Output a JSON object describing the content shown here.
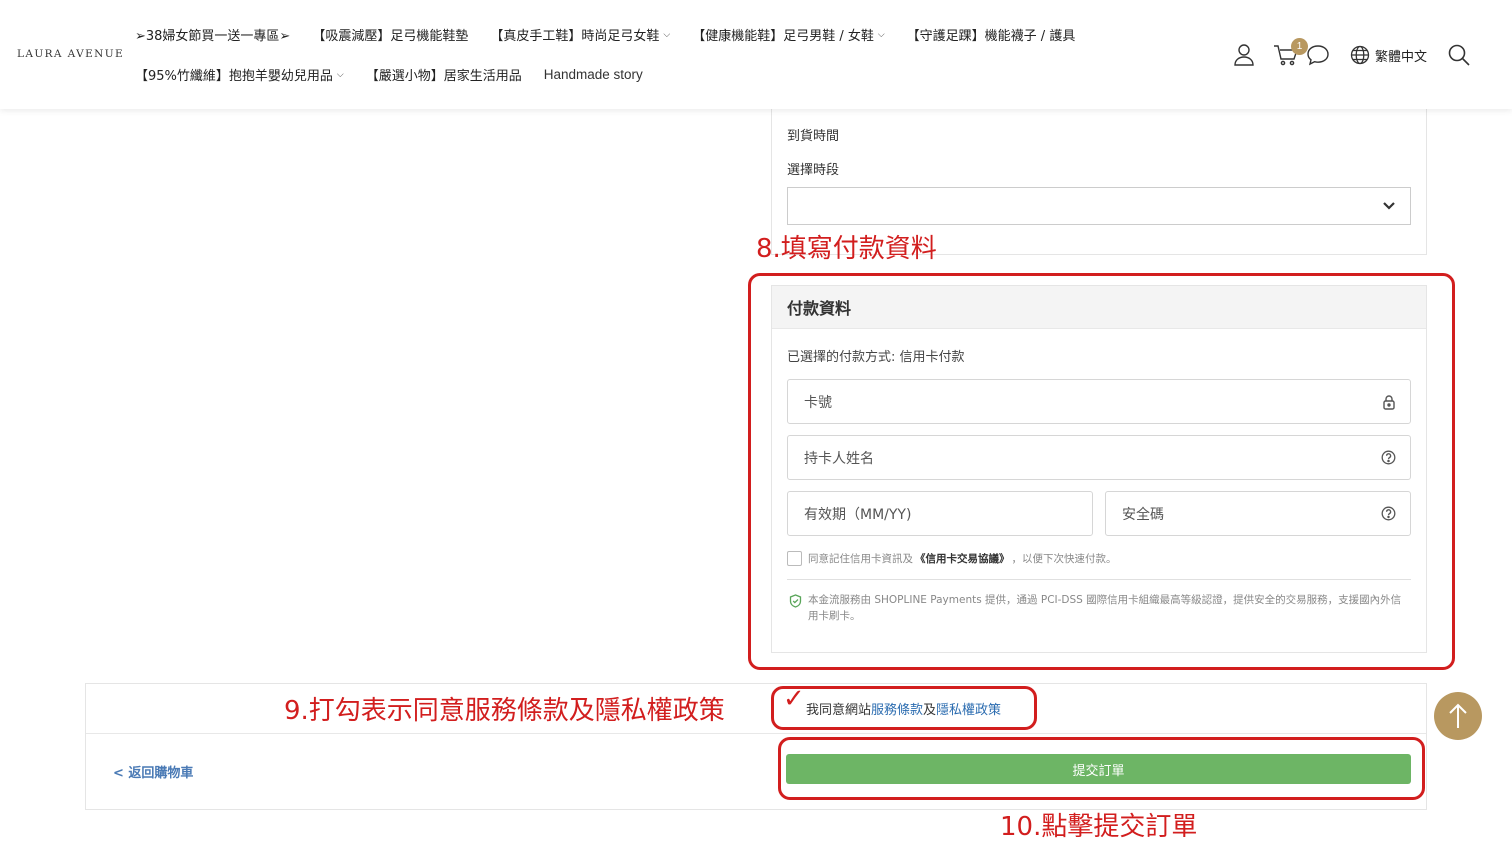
{
  "header": {
    "brand": "LAURA AVENUE",
    "nav_row1": [
      {
        "label": "➢38婦女節買一送一專區➢",
        "has_chevron": false
      },
      {
        "label": "【吸震減壓】足弓機能鞋墊",
        "has_chevron": false
      },
      {
        "label": "【真皮手工鞋】時尚足弓女鞋",
        "has_chevron": true
      },
      {
        "label": "【健康機能鞋】足弓男鞋 / 女鞋",
        "has_chevron": true
      },
      {
        "label": "【守護足踝】機能襪子 / 護具",
        "has_chevron": false
      }
    ],
    "nav_row2": [
      {
        "label": "【95%竹纖維】抱抱羊嬰幼兒用品",
        "has_chevron": true
      },
      {
        "label": "【嚴選小物】居家生活用品",
        "has_chevron": false
      },
      {
        "label": "Handmade story",
        "has_chevron": false
      }
    ],
    "cart_count": "1",
    "language": "繁體中文",
    "icons": [
      "user-icon",
      "cart-icon",
      "chat-icon",
      "globe-icon",
      "search-icon"
    ]
  },
  "delivery": {
    "arrival_label": "到貨時間",
    "slot_label": "選擇時段",
    "slot_value": ""
  },
  "annotations": {
    "step8": "8.填寫付款資料",
    "step9": "9.打勾表示同意服務條款及隱私權政策",
    "step10": "10.點擊提交訂單",
    "check": "✓"
  },
  "payment": {
    "title": "付款資料",
    "method_text": "已選擇的付款方式: 信用卡付款",
    "card_number_placeholder": "卡號",
    "holder_placeholder": "持卡人姓名",
    "expiry_placeholder": "有效期（MM/YY)",
    "cvc_placeholder": "安全碼",
    "remember_prefix": "同意記住信用卡資訊及",
    "remember_link": "《信用卡交易協議》",
    "remember_suffix": "，以便下次快速付款。",
    "secure_text": "本金流服務由 SHOPLINE Payments 提供，通過 PCI-DSS 國際信用卡組織最高等級認證，提供安全的交易服務，支援國內外信用卡刷卡。"
  },
  "footer": {
    "terms_prefix": "我同意網站",
    "terms_link": "服務條款",
    "terms_and": "及",
    "privacy_link": "隱私權政策",
    "back_label": "< 返回購物車",
    "submit_label": "提交訂單"
  },
  "colors": {
    "annotation_red": "#d21e1e",
    "submit_green": "#6db565",
    "accent_gold": "#b89860",
    "link_blue": "#2b6cb0"
  }
}
